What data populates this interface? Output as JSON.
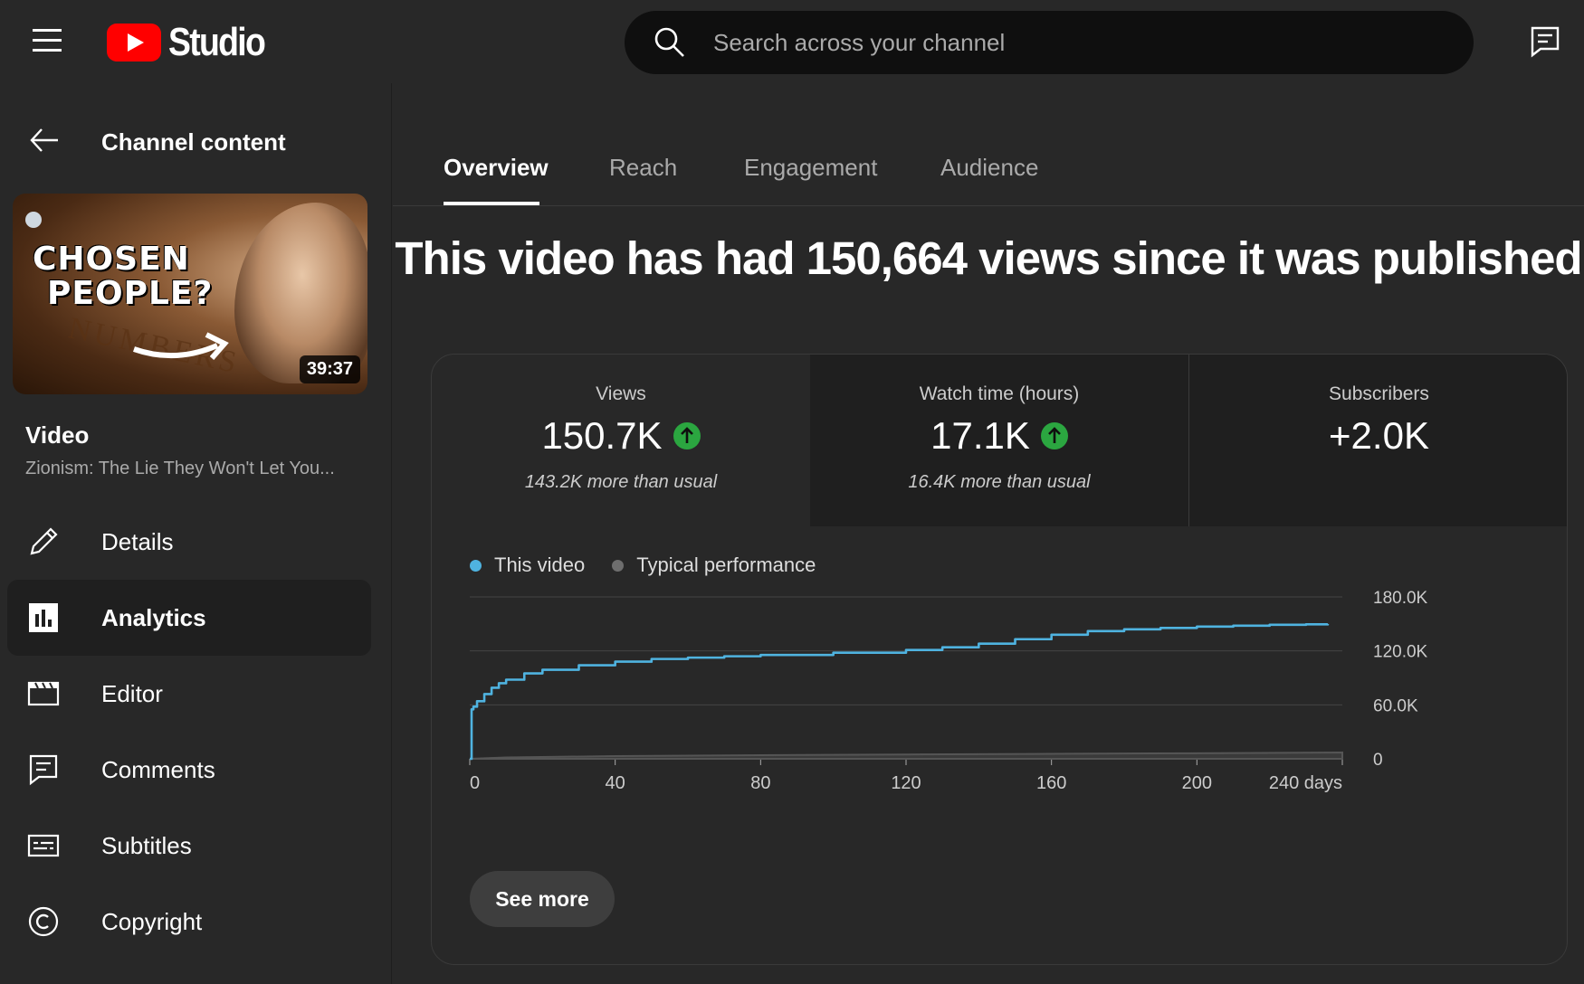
{
  "header": {
    "logo_text": "Studio",
    "search_placeholder": "Search across your channel"
  },
  "sidebar": {
    "back_label": "Channel content",
    "thumbnail": {
      "line1": "CHOSEN",
      "line2": "PEOPLE?",
      "background_text": "NUMBERS",
      "duration": "39:37"
    },
    "video_label": "Video",
    "video_title": "Zionism: The Lie They Won't Let You...",
    "items": [
      {
        "label": "Details",
        "icon": "pencil-icon"
      },
      {
        "label": "Analytics",
        "icon": "analytics-icon",
        "active": true
      },
      {
        "label": "Editor",
        "icon": "clapperboard-icon"
      },
      {
        "label": "Comments",
        "icon": "comments-icon"
      },
      {
        "label": "Subtitles",
        "icon": "subtitles-icon"
      },
      {
        "label": "Copyright",
        "icon": "copyright-icon"
      }
    ]
  },
  "tabs": [
    "Overview",
    "Reach",
    "Engagement",
    "Audience"
  ],
  "headline": "This video has had 150,664 views since it was published",
  "metrics": [
    {
      "label": "Views",
      "value": "150.7K",
      "trend": "up",
      "note": "143.2K more than usual"
    },
    {
      "label": "Watch time (hours)",
      "value": "17.1K",
      "trend": "up",
      "note": "16.4K more than usual"
    },
    {
      "label": "Subscribers",
      "value": "+2.0K"
    }
  ],
  "see_more": "See more",
  "colors": {
    "accent_line": "#4fb3e0",
    "trend_up": "#2ba640",
    "typical": "#6e6e6e"
  },
  "chart_data": {
    "type": "line",
    "legend": [
      "This video",
      "Typical performance"
    ],
    "xlabel": "days",
    "x_ticks": [
      "0",
      "40",
      "80",
      "120",
      "160",
      "200",
      "240 days"
    ],
    "y_ticks": [
      "180.0K",
      "120.0K",
      "60.0K",
      "0"
    ],
    "xlim": [
      0,
      240
    ],
    "ylim": [
      0,
      180000
    ],
    "series": [
      {
        "name": "This video",
        "x": [
          0,
          0.5,
          1,
          2,
          4,
          6,
          8,
          10,
          15,
          20,
          30,
          40,
          50,
          60,
          70,
          80,
          100,
          120,
          130,
          140,
          150,
          160,
          170,
          180,
          190,
          200,
          210,
          220,
          230,
          236
        ],
        "y": [
          0,
          55000,
          58000,
          64000,
          72000,
          79000,
          84000,
          88000,
          95000,
          99000,
          104000,
          108000,
          111000,
          112500,
          114000,
          115500,
          118000,
          121000,
          124000,
          128000,
          133000,
          138000,
          142000,
          144000,
          145500,
          147000,
          148000,
          149000,
          149500,
          150000
        ]
      },
      {
        "name": "Typical performance",
        "x": [
          0,
          10,
          40,
          80,
          120,
          160,
          200,
          240
        ],
        "y": [
          0,
          1500,
          3000,
          4000,
          4800,
          5500,
          6200,
          7000
        ]
      }
    ]
  }
}
